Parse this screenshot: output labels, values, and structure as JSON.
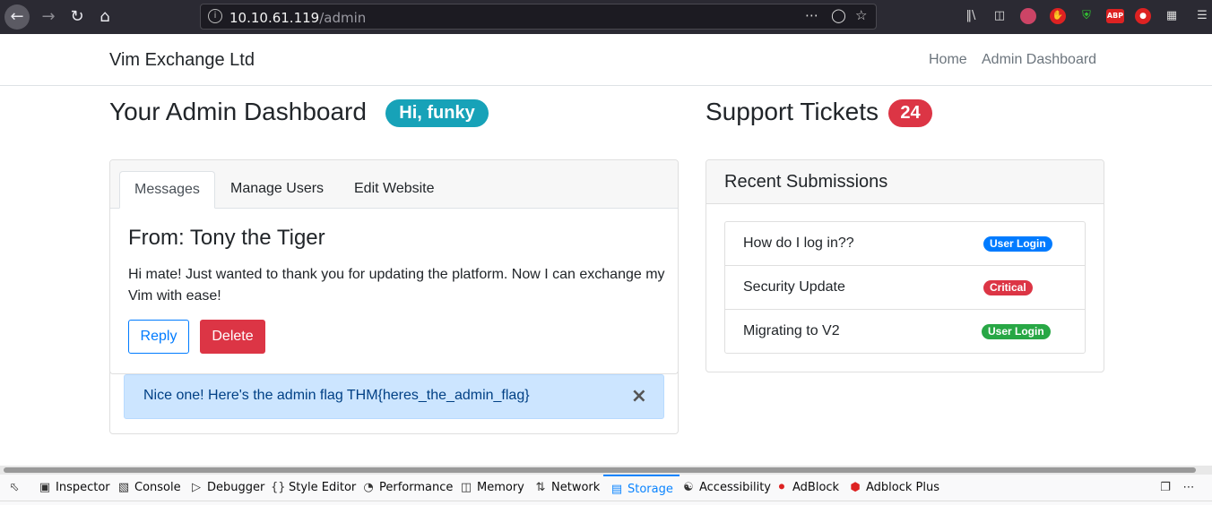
{
  "browser": {
    "url_host": "10.10.61.119",
    "url_path": "/admin",
    "icons": [
      "back-arrow-icon",
      "forward-arrow-icon",
      "reload-icon",
      "home-icon",
      "info-icon",
      "more-dots-icon",
      "pocket-icon",
      "bookmark-star-icon",
      "library-icon",
      "sidebar-icon",
      "avatar-icon",
      "ublock-icon",
      "shield-icon",
      "abp-icon",
      "lock-icon",
      "toolbar-grid-icon",
      "menu-icon"
    ],
    "abp_label": "ABP"
  },
  "navbar": {
    "brand": "Vim Exchange Ltd",
    "links": [
      "Home",
      "Admin Dashboard"
    ]
  },
  "dashboard": {
    "title": "Your Admin Dashboard",
    "greeting": "Hi, funky",
    "greeting_color": "#17a2b8"
  },
  "messages_card": {
    "tabs": [
      "Messages",
      "Manage Users",
      "Edit Website"
    ],
    "active_tab": "Messages",
    "from": "From: Tony the Tiger",
    "body": "Hi mate! Just wanted to thank you for updating the platform. Now I can exchange my Vim with ease!",
    "reply_label": "Reply",
    "delete_label": "Delete",
    "alert_text": "Nice one! Here's the admin flag THM{heres_the_admin_flag}",
    "alert_close": "×"
  },
  "support": {
    "title": "Support Tickets",
    "count": "24",
    "count_color": "#dc3545",
    "recent_header": "Recent Submissions",
    "tickets": [
      {
        "title": "How do I log in??",
        "badge": "User Login",
        "color": "#007bff"
      },
      {
        "title": "Security Update",
        "badge": "Critical",
        "color": "#dc3545"
      },
      {
        "title": "Migrating to V2",
        "badge": "User Login",
        "color": "#28a745"
      }
    ]
  },
  "devtools": {
    "tabs": [
      "Inspector",
      "Console",
      "Debugger",
      "Style Editor",
      "Performance",
      "Memory",
      "Network",
      "Storage",
      "Accessibility",
      "AdBlock",
      "Adblock Plus"
    ],
    "active_tab": "Storage"
  }
}
